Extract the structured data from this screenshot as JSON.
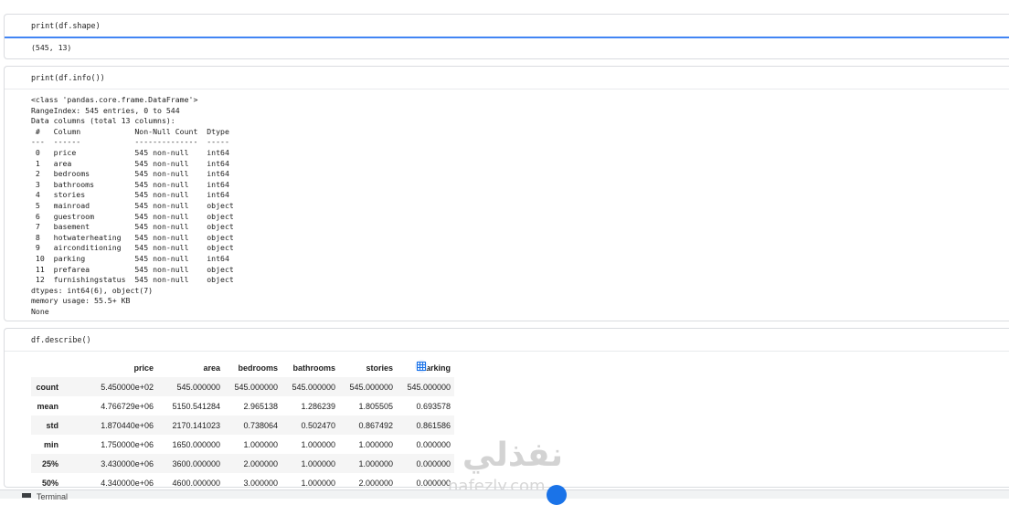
{
  "cells": [
    {
      "code": "print(df.shape)",
      "output": "(545, 13)"
    },
    {
      "code": "print(df.info())",
      "output": "<class 'pandas.core.frame.DataFrame'>\nRangeIndex: 545 entries, 0 to 544\nData columns (total 13 columns):\n #   Column            Non-Null Count  Dtype \n---  ------            --------------  ----- \n 0   price             545 non-null    int64 \n 1   area              545 non-null    int64 \n 2   bedrooms          545 non-null    int64 \n 3   bathrooms         545 non-null    int64 \n 4   stories           545 non-null    int64 \n 5   mainroad          545 non-null    object\n 6   guestroom         545 non-null    object\n 7   basement          545 non-null    object\n 8   hotwaterheating   545 non-null    object\n 9   airconditioning   545 non-null    object\n 10  parking           545 non-null    int64 \n 11  prefarea          545 non-null    object\n 12  furnishingstatus  545 non-null    object\ndtypes: int64(6), object(7)\nmemory usage: 55.5+ KB\nNone"
    },
    {
      "code": "df.describe()"
    }
  ],
  "describe": {
    "columns": [
      "price",
      "area",
      "bedrooms",
      "bathrooms",
      "stories",
      "parking"
    ],
    "rows": [
      {
        "index": "count",
        "values": [
          "5.450000e+02",
          "545.000000",
          "545.000000",
          "545.000000",
          "545.000000",
          "545.000000"
        ]
      },
      {
        "index": "mean",
        "values": [
          "4.766729e+06",
          "5150.541284",
          "2.965138",
          "1.286239",
          "1.805505",
          "0.693578"
        ]
      },
      {
        "index": "std",
        "values": [
          "1.870440e+06",
          "2170.141023",
          "0.738064",
          "0.502470",
          "0.867492",
          "0.861586"
        ]
      },
      {
        "index": "min",
        "values": [
          "1.750000e+06",
          "1650.000000",
          "1.000000",
          "1.000000",
          "1.000000",
          "0.000000"
        ]
      },
      {
        "index": "25%",
        "values": [
          "3.430000e+06",
          "3600.000000",
          "2.000000",
          "1.000000",
          "1.000000",
          "0.000000"
        ]
      },
      {
        "index": "50%",
        "values": [
          "4.340000e+06",
          "4600.000000",
          "3.000000",
          "1.000000",
          "2.000000",
          "0.000000"
        ]
      }
    ]
  },
  "watermark": {
    "arabic": "نفذلي",
    "latin": "nafezly.com"
  },
  "bottom_bar": {
    "label": "Terminal"
  },
  "colors": {
    "accent": "#4285f4",
    "row_stripe": "#f5f5f5",
    "border": "#dadce0"
  }
}
